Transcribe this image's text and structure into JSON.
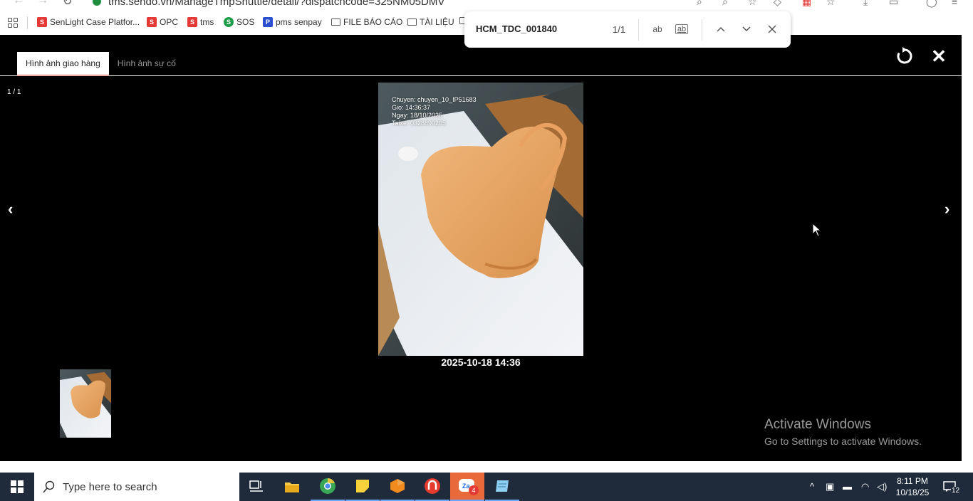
{
  "browser": {
    "url": "tms.sendo.vn/ManageTmpShuttle/detail/?dispatchcode=325NM05DMV",
    "bookmarks": [
      {
        "label": "SenLight Case Platfor...",
        "color": "#e53935",
        "icon": "sendo-icon"
      },
      {
        "label": "OPC",
        "color": "#e53935",
        "icon": "sendo-icon"
      },
      {
        "label": "tms",
        "color": "#e53935",
        "icon": "sendo-icon"
      },
      {
        "label": "SOS",
        "color": "#1e9e4a",
        "icon": "sos-icon"
      },
      {
        "label": "pms senpay",
        "color": "#2b4fcf",
        "icon": "pms-icon"
      },
      {
        "label": "FILE BÁO CÁO",
        "icon": "folder-icon"
      },
      {
        "label": "TÀI LIỆU",
        "icon": "folder-icon"
      }
    ]
  },
  "find": {
    "query": "HCM_TDC_001840",
    "count": "1/1",
    "case_label": "ab",
    "whole_word_label": "ab"
  },
  "viewer": {
    "tabs": [
      {
        "label": "Hình ảnh giao hàng",
        "active": true
      },
      {
        "label": "Hình ảnh sự cố",
        "active": false
      }
    ],
    "counter": "1 / 1",
    "prev_label": "‹",
    "next_label": "›",
    "close_label": "✕",
    "photo": {
      "watermark": [
        "Chuyen: chuyen_10_IP51683",
        "Gio: 14:36:37",
        "Ngay: 18/10/2025",
        "Taixe: 0328890205"
      ],
      "caption": "2025-10-18 14:36"
    }
  },
  "windows": {
    "activate_title": "Activate Windows",
    "activate_sub": "Go to Settings to activate Windows."
  },
  "taskbar": {
    "search_placeholder": "Type here to search",
    "zalo_badge": "4",
    "time": "8:11 PM",
    "date": "10/18/25",
    "notifications": "12"
  }
}
